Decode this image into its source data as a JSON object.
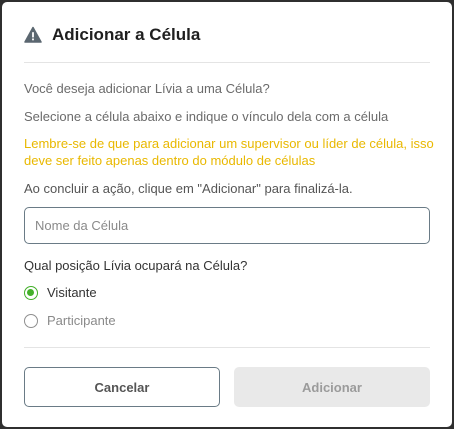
{
  "modal": {
    "title": "Adicionar a Célula",
    "icon": "warning-icon",
    "question_text": "Você deseja adicionar Lívia a uma Célula?",
    "instruction_text": "Selecione a célula abaixo e indique o vínculo dela com a célula",
    "warning_text": "Lembre-se de que para adicionar um supervisor ou líder de célula, isso deve ser feito apenas dentro do módulo de células",
    "conclude_text": "Ao concluir a ação, clique em \"Adicionar\" para finalizá-la.",
    "cell_name": {
      "value": "",
      "placeholder": "Nome da Célula"
    },
    "position_question": "Qual posição Lívia ocupará na Célula?",
    "options": [
      {
        "label": "Visitante",
        "selected": true
      },
      {
        "label": "Participante",
        "selected": false
      }
    ],
    "buttons": {
      "cancel": "Cancelar",
      "add": "Adicionar"
    }
  },
  "colors": {
    "warning_text": "#e9b800",
    "radio_selected": "#43b02a",
    "disabled_button_bg": "#e9e9e9"
  }
}
